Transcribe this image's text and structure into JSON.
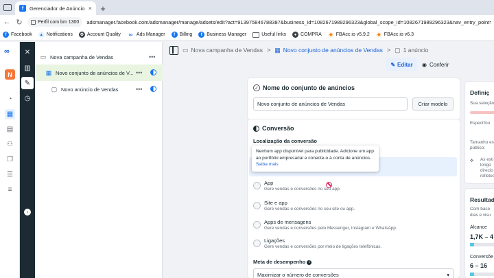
{
  "browser": {
    "tab_title": "Gerenciador de Anúncios - Ge",
    "tab_close": "×",
    "new_tab": "+",
    "profile": "Perfil com bm 1300",
    "url": "adsmanager.facebook.com/adsmanager/manage/adsets/edit?act=913975846788387&business_id=1082671989296323&global_scope_id=1082671989296323&nav_entry_point=am_loca",
    "bookmarks": [
      {
        "label": "Facebook",
        "icon": "facebook-icon"
      },
      {
        "label": "Notifications",
        "icon": "bell-icon"
      },
      {
        "label": "Account Quality",
        "icon": "gear-icon"
      },
      {
        "label": "Ads Manager",
        "icon": "meta-icon"
      },
      {
        "label": "Billing",
        "icon": "facebook-icon"
      },
      {
        "label": "Business Manager",
        "icon": "facebook-icon"
      },
      {
        "label": "Useful links",
        "icon": "folder-icon"
      },
      {
        "label": "COMPRA",
        "icon": "circle-icon"
      },
      {
        "label": "FBAcc.io v5.9.2",
        "icon": "chart-icon"
      },
      {
        "label": "FBAcc.io v6.3",
        "icon": "chart-icon"
      }
    ]
  },
  "rail": {
    "account_initial": "N"
  },
  "tree": {
    "campaign": "Nova campanha de Vendas",
    "adset": "Novo conjunto de anúncios de V...",
    "ad": "Novo anúncio de Vendas",
    "more": "•••"
  },
  "breadcrumb": {
    "campaign": "Nova campanha de Vendas",
    "adset": "Novo conjunto de anúncios de Vendas",
    "ads": "1 anúncio",
    "sep": ">"
  },
  "toolbar": {
    "edit_label": "Editar",
    "review_label": "Conferir"
  },
  "name_card": {
    "title": "Nome do conjunto de anúncios",
    "input_value": "Novo conjunto de anúncios de Vendas",
    "template_button": "Criar modelo"
  },
  "conversion_card": {
    "title": "Conversão",
    "location_label": "Localização da conversão",
    "tooltip": "Nenhum app disponível para publicidade. Adicione um app ao portfólio empresarial e conecte-o à conta de anúncios.",
    "tooltip_link": "Saiba mais",
    "options": [
      {
        "title": "App",
        "desc": "Gere vendas e conversões no seu app."
      },
      {
        "title": "Site e app",
        "desc": "Gere vendas e conversões no seu site ou app."
      },
      {
        "title": "Apps de mensagens",
        "desc": "Gere vendas e conversões pelo Messenger, Instagram e WhatsApp."
      },
      {
        "title": "Ligações",
        "desc": "Gere vendas e conversões por meio de ligações telefônicas."
      }
    ],
    "goal_label": "Meta de desempenho",
    "goal_value": "Maximizar o número de conversões"
  },
  "side_panel": {
    "def_title": "Definiç",
    "def_sub": "Sua seleção",
    "specific": "Específico",
    "size_label_1": "Tamanho es",
    "size_label_2": "público:",
    "note_lines": [
      "As esti",
      "longo",
      "direcio",
      "refletec"
    ],
    "results_title": "Resultad",
    "results_text_1": "Com base",
    "results_text_2": "dias e visu",
    "reach_label": "Alcance",
    "reach_value": "1,7K – 4",
    "conv_label": "Conversõe",
    "conv_value": "6 – 16"
  }
}
